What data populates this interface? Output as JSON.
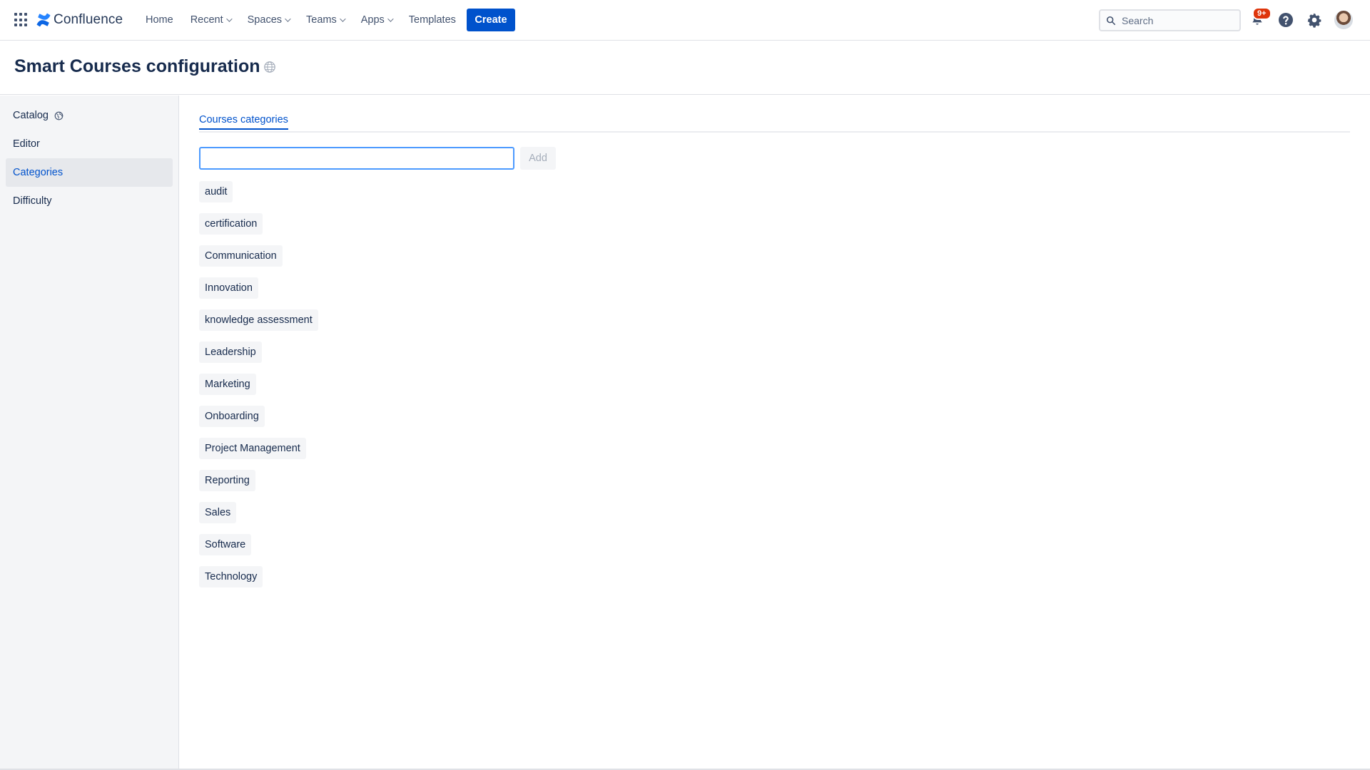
{
  "nav": {
    "logo_text": "Confluence",
    "items": [
      {
        "label": "Home",
        "dropdown": false
      },
      {
        "label": "Recent",
        "dropdown": true
      },
      {
        "label": "Spaces",
        "dropdown": true
      },
      {
        "label": "Teams",
        "dropdown": true
      },
      {
        "label": "Apps",
        "dropdown": true
      },
      {
        "label": "Templates",
        "dropdown": false
      }
    ],
    "create_label": "Create",
    "search_placeholder": "Search",
    "notification_badge": "9+",
    "icons": {
      "app_switcher": "app-switcher-icon",
      "notifications": "bell-icon",
      "help": "help-icon",
      "settings": "gear-icon",
      "profile": "avatar"
    },
    "brand_color": "#0052cc"
  },
  "page": {
    "title": "Smart Courses configuration",
    "title_icon": "globe-icon"
  },
  "sidebar": {
    "items": [
      {
        "label": "Catalog",
        "icon": "globe-icon",
        "active": false
      },
      {
        "label": "Editor",
        "icon": null,
        "active": false
      },
      {
        "label": "Categories",
        "icon": null,
        "active": true
      },
      {
        "label": "Difficulty",
        "icon": null,
        "active": false
      }
    ]
  },
  "main": {
    "tab_label": "Courses categories",
    "input_value": "",
    "add_label": "Add",
    "categories": [
      "audit",
      "certification",
      "Communication",
      "Innovation",
      "knowledge assessment",
      "Leadership",
      "Marketing",
      "Onboarding",
      "Project Management",
      "Reporting",
      "Sales",
      "Software",
      "Technology"
    ]
  }
}
